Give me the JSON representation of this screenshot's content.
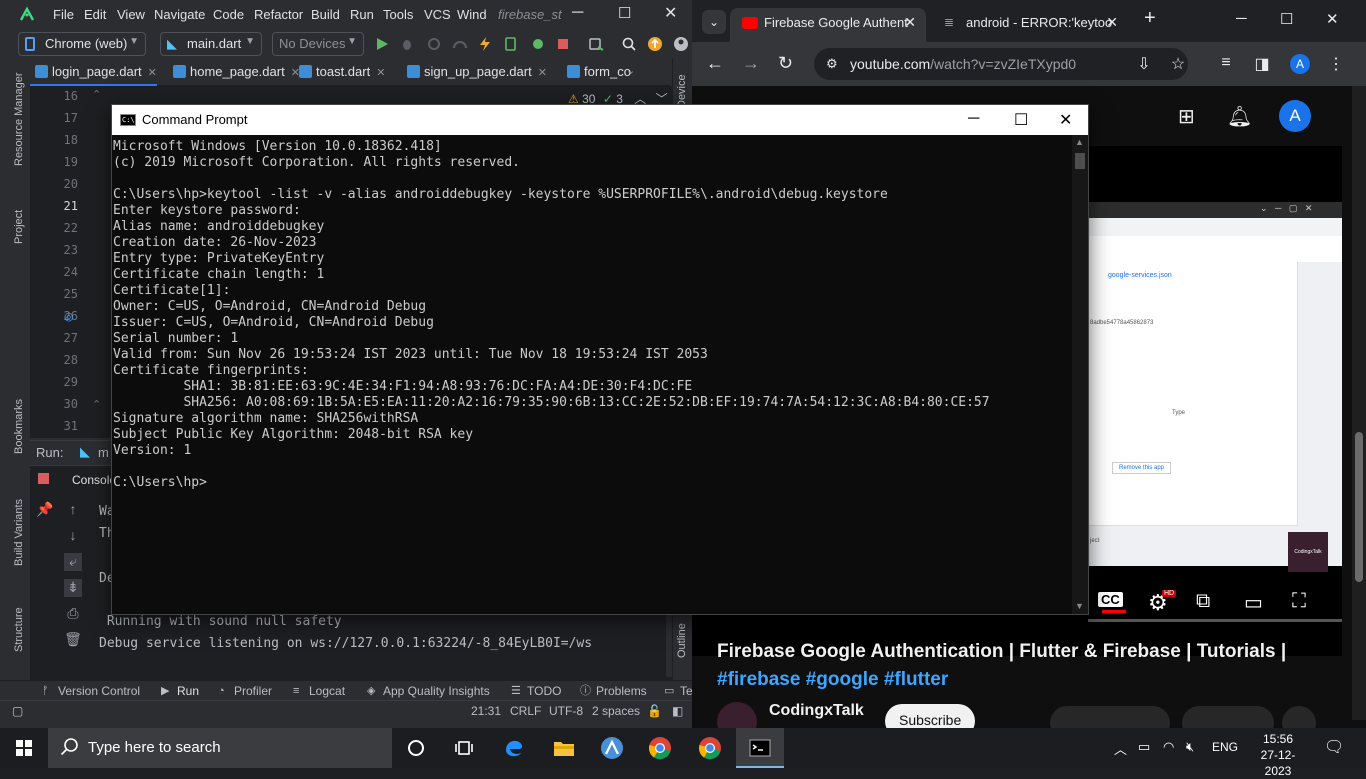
{
  "ide": {
    "menu": [
      "File",
      "Edit",
      "View",
      "Navigate",
      "Code",
      "Refactor",
      "Build",
      "Run",
      "Tools",
      "VCS",
      "Wind",
      "firebase_st"
    ],
    "device_combo": "Chrome (web)",
    "config_combo": "main.dart",
    "no_devices": "No Devices",
    "tabs": [
      "login_page.dart",
      "home_page.dart",
      "toast.dart",
      "sign_up_page.dart",
      "form_co"
    ],
    "inspection": {
      "warnings": "30",
      "weak": "3"
    },
    "line_numbers": [
      "16",
      "17",
      "18",
      "19",
      "20",
      "21",
      "22",
      "23",
      "24",
      "25",
      "26",
      "27",
      "28",
      "29",
      "30",
      "31"
    ],
    "left_strip": [
      "Resource Manager",
      "Project",
      "Bookmarks",
      "Build Variants",
      "Structure"
    ],
    "right_strip": [
      "Device",
      "Outline"
    ],
    "run_label": "Run:",
    "run_config": "m",
    "console_label": "Console",
    "console_fragments": [
      "Wa",
      "Th",
      "De"
    ],
    "console_lines": [
      " Running with sound null safety",
      "Debug service listening on ws://127.0.0.1:63224/-8_84EyLB0I=/ws"
    ],
    "bottom_tools": [
      "Version Control",
      "Run",
      "Profiler",
      "Logcat",
      "App Quality Insights",
      "TODO",
      "Problems",
      "Te"
    ],
    "status": {
      "position": "21:31",
      "line_sep": "CRLF",
      "encoding": "UTF-8",
      "indent": "2 spaces"
    }
  },
  "chrome": {
    "tabs": [
      {
        "title": "Firebase Google Authent",
        "active": true
      },
      {
        "title": "android - ERROR:'keytoo",
        "active": false
      }
    ],
    "url_host": "youtube.com",
    "url_path": "/watch?v=zvZIeTXypd0",
    "profile_initial": "A"
  },
  "youtube": {
    "avatar": "A",
    "title": "Firebase Google Authentication | Flutter & Firebase | Tutorials |",
    "hashtags": "#firebase #google #flutter",
    "channel": "CodingxTalk",
    "subscribe": "Subscribe",
    "hd_badge": "HD",
    "inner_screenshot": {
      "file": "google-services.json",
      "fragment": "8adbe54778a45862873",
      "type_label": "Type",
      "remove_btn": "Remove this app",
      "project_label": "ject",
      "watermark": "CodingxTalk"
    }
  },
  "cmd": {
    "title": "Command Prompt",
    "lines": [
      "Microsoft Windows [Version 10.0.18362.418]",
      "(c) 2019 Microsoft Corporation. All rights reserved.",
      "",
      "C:\\Users\\hp>keytool -list -v -alias androiddebugkey -keystore %USERPROFILE%\\.android\\debug.keystore",
      "Enter keystore password:",
      "Alias name: androiddebugkey",
      "Creation date: 26-Nov-2023",
      "Entry type: PrivateKeyEntry",
      "Certificate chain length: 1",
      "Certificate[1]:",
      "Owner: C=US, O=Android, CN=Android Debug",
      "Issuer: C=US, O=Android, CN=Android Debug",
      "Serial number: 1",
      "Valid from: Sun Nov 26 19:53:24 IST 2023 until: Tue Nov 18 19:53:24 IST 2053",
      "Certificate fingerprints:",
      "         SHA1: 3B:81:EE:63:9C:4E:34:F1:94:A8:93:76:DC:FA:A4:DE:30:F4:DC:FE",
      "         SHA256: A0:08:69:1B:5A:E5:EA:11:20:A2:16:79:35:90:6B:13:CC:2E:52:DB:EF:19:74:7A:54:12:3C:A8:B4:80:CE:57",
      "Signature algorithm name: SHA256withRSA",
      "Subject Public Key Algorithm: 2048-bit RSA key",
      "Version: 1",
      "",
      "C:\\Users\\hp>"
    ]
  },
  "taskbar": {
    "search_placeholder": "Type here to search",
    "language": "ENG",
    "time": "15:56",
    "date": "27-12-2023"
  },
  "colors": {
    "ide_bg": "#2b2d30",
    "editor_bg": "#1e1f22",
    "accent_blue": "#3574f0",
    "youtube_red": "#ff0000",
    "cmd_bg": "#0c0c0c",
    "cmd_fg": "#cccccc",
    "taskbar_bg": "#1b1d20"
  }
}
